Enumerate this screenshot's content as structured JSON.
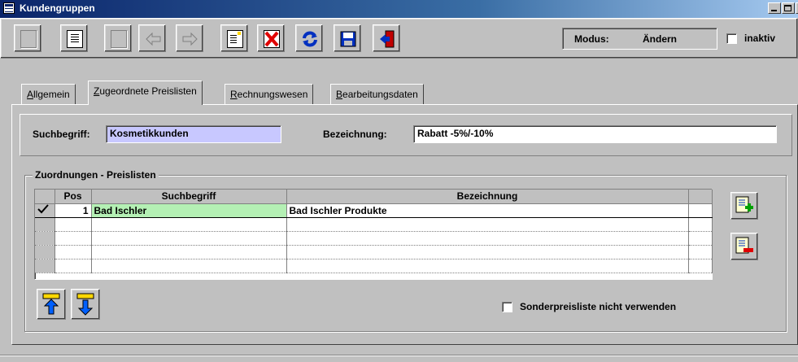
{
  "window": {
    "title": "Kundengruppen"
  },
  "toolbar": {
    "modus_label": "Modus:",
    "modus_value": "Ändern",
    "inaktiv_label": "inaktiv",
    "inaktiv_checked": false
  },
  "tabs": [
    {
      "label": "Allgemein",
      "active": false
    },
    {
      "label": "Zugeordnete Preislisten",
      "active": true
    },
    {
      "label": "Rechnungswesen",
      "active": false
    },
    {
      "label": "Bearbeitungsdaten",
      "active": false
    }
  ],
  "form": {
    "suchbegriff_label": "Suchbegriff:",
    "suchbegriff_value": "Kosmetikkunden",
    "bezeichnung_label": "Bezeichnung:",
    "bezeichnung_value": "Rabatt -5%/-10%"
  },
  "group": {
    "title": "Zuordnungen - Preislisten",
    "columns": [
      "Pos",
      "Suchbegriff",
      "Bezeichnung"
    ],
    "rows": [
      {
        "pos": "1",
        "suchbegriff": "Bad Ischler",
        "bezeichnung": "Bad Ischler Produkte",
        "checked": true
      },
      {
        "pos": "",
        "suchbegriff": "",
        "bezeichnung": "",
        "checked": false
      },
      {
        "pos": "",
        "suchbegriff": "",
        "bezeichnung": "",
        "checked": false
      },
      {
        "pos": "",
        "suchbegriff": "",
        "bezeichnung": "",
        "checked": false
      },
      {
        "pos": "",
        "suchbegriff": "",
        "bezeichnung": "",
        "checked": false
      }
    ],
    "sonder_label": "Sonderpreisliste nicht verwenden",
    "sonder_checked": false
  },
  "colors": {
    "search_field_bg": "#c8c8ff",
    "selected_cell_bg": "#b4f0b4",
    "titlebar": "#0a246a"
  }
}
